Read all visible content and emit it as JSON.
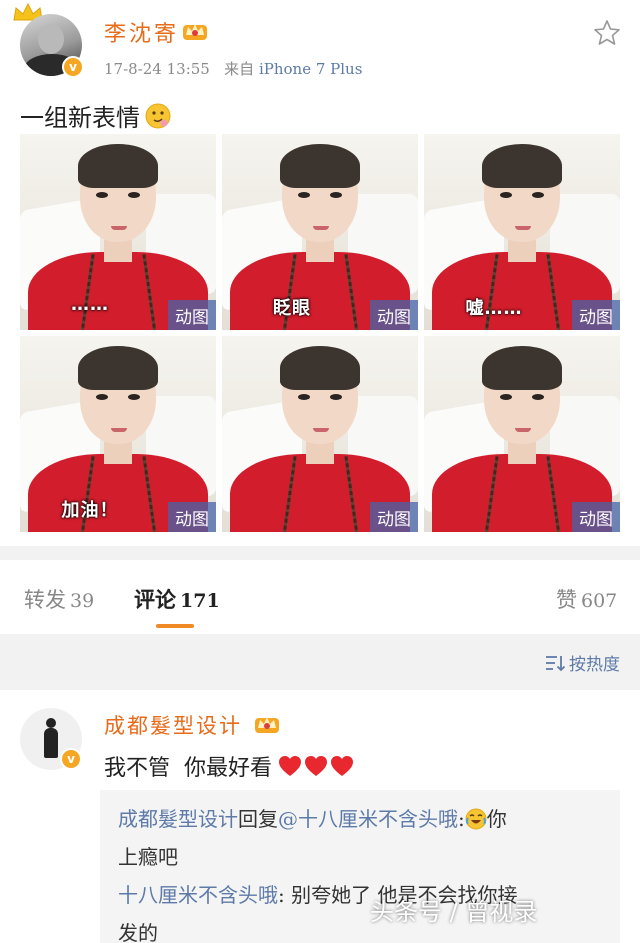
{
  "post": {
    "username": "李沈寄",
    "timestamp": "17-8-24 13:55",
    "source_prefix": "来自",
    "device": "iPhone 7 Plus",
    "text": "一组新表情",
    "verified_mark": "v",
    "images": [
      {
        "caption": "",
        "tag": "动图"
      },
      {
        "caption": "",
        "tag": "动图"
      },
      {
        "caption": "",
        "tag": "动图"
      },
      {
        "caption": "",
        "tag": "动图"
      },
      {
        "caption": "",
        "tag": "动图"
      },
      {
        "caption": "",
        "tag": "动图"
      }
    ],
    "captions": [
      "……",
      "眨眼",
      "嘘……",
      "加油！"
    ]
  },
  "tabs": {
    "repost_label": "转发",
    "repost_count": "39",
    "comment_label": "评论",
    "comment_count": "171",
    "like_label": "赞",
    "like_count": "607"
  },
  "sortbar": {
    "label": "按热度"
  },
  "comment": {
    "username": "成都髮型设计",
    "text": "我不管  你最好看",
    "reply_author": "成都髮型设计",
    "reply_verb": "回复",
    "reply_target": "@十八厘米不含头哦",
    "reply_colon": ":",
    "reply_text_1": "你",
    "reply_text_2": "上瘾吧",
    "second_author": "十八厘米不含头哦",
    "second_text": ": 别夸她了 他是不会找你接",
    "second_text_2": "发的"
  },
  "watermark": "头条号 / 曾视录",
  "colors": {
    "username": "#e86b1a",
    "link": "#5d7aa8",
    "accent": "#f08a24",
    "badge": "#f5a623",
    "gif_tag": "#4664aa",
    "shirt": "#d21d2c"
  }
}
